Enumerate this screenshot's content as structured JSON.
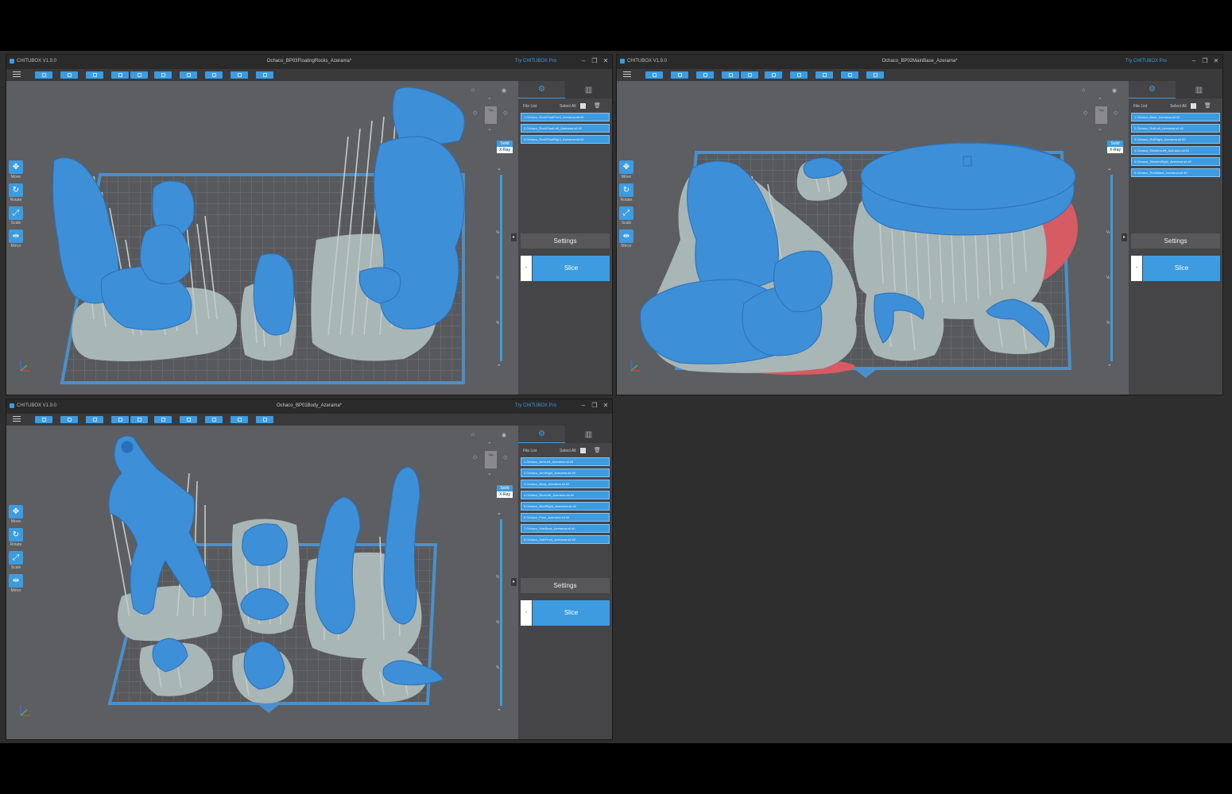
{
  "colors": {
    "accent": "#3d9be0",
    "model": "#3d8fd8",
    "support": "#9aa7a7",
    "plate": "#565659",
    "grid": "#78797c",
    "border": "#4a90cc",
    "warn": "#d65b63"
  },
  "common": {
    "app_name": "CHITUBOX V1.9.0",
    "pro_link": "Try CHITUBOX Pro",
    "icons": {
      "minimize": "minimize-icon",
      "restore": "restore-icon",
      "close": "close-icon",
      "menu": "hamburger-menu-icon"
    },
    "tools": [
      {
        "label": "Move",
        "icon": "move-icon"
      },
      {
        "label": "Rotate",
        "icon": "rotate-icon"
      },
      {
        "label": "Scale",
        "icon": "scale-icon"
      },
      {
        "label": "Mirror",
        "icon": "mirror-icon"
      }
    ],
    "view_cube_label": "Top",
    "view_modes": {
      "solid": "Solid",
      "xray": "X-Ray"
    },
    "slider_ticks": [
      "¼",
      "½",
      "¾"
    ],
    "file_list_label": "File List",
    "select_all_label": "Select All",
    "settings_label": "Settings",
    "slice_label": "Slice",
    "minus_label": "-"
  },
  "windows": [
    {
      "title": "Ochaco_BP03FloatingRocks_Azerama*",
      "files": [
        "1.Ochaco_RockFloatFront_Azerama.stl #0",
        "2.Ochaco_RockFloatLeft_Azerama.stl #0",
        "3.Ochaco_RockFloatRight_Azerama.stl #0"
      ]
    },
    {
      "title": "Ochaco_BP02MainBase_Azerama*",
      "files": [
        "1.Ochaco_Base_Azerama.stl #0",
        "2.Ochaco_RollLeft_Azerama.stl #0",
        "3.Ochaco_RollRight_Azerama.stl #0",
        "4.Ochaco_StickersLeft_Azerama.stl #0",
        "5.Ochaco_StickersRight_Azerama.stl #0",
        "6.Ochaco_RockBase_Azerama.stl #0"
      ]
    },
    {
      "title": "Ochaco_BP01Body_Azerama*",
      "files": [
        "1.Ochaco_ArmLeft_Azerama.stl #0",
        "2.Ochaco_ArmRight_Azerama.stl #0",
        "3.Ochaco_Body_Azerama.stl #0",
        "4.Ochaco_BootLeft_Azerama.stl #0",
        "5.Ochaco_BootRight_Azerama.stl #0",
        "6.Ochaco_Face_Azerama.stl #0",
        "7.Ochaco_HairBack_Azerama.stl #0",
        "8.Ochaco_HairFront_Azerama.stl #0"
      ]
    }
  ]
}
